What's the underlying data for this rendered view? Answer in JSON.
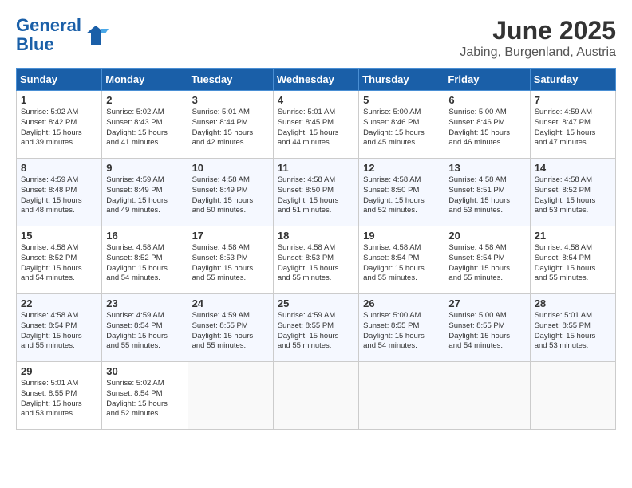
{
  "header": {
    "logo_line1": "General",
    "logo_line2": "Blue",
    "month": "June 2025",
    "location": "Jabing, Burgenland, Austria"
  },
  "weekdays": [
    "Sunday",
    "Monday",
    "Tuesday",
    "Wednesday",
    "Thursday",
    "Friday",
    "Saturday"
  ],
  "weeks": [
    [
      {
        "day": "1",
        "info": "Sunrise: 5:02 AM\nSunset: 8:42 PM\nDaylight: 15 hours\nand 39 minutes."
      },
      {
        "day": "2",
        "info": "Sunrise: 5:02 AM\nSunset: 8:43 PM\nDaylight: 15 hours\nand 41 minutes."
      },
      {
        "day": "3",
        "info": "Sunrise: 5:01 AM\nSunset: 8:44 PM\nDaylight: 15 hours\nand 42 minutes."
      },
      {
        "day": "4",
        "info": "Sunrise: 5:01 AM\nSunset: 8:45 PM\nDaylight: 15 hours\nand 44 minutes."
      },
      {
        "day": "5",
        "info": "Sunrise: 5:00 AM\nSunset: 8:46 PM\nDaylight: 15 hours\nand 45 minutes."
      },
      {
        "day": "6",
        "info": "Sunrise: 5:00 AM\nSunset: 8:46 PM\nDaylight: 15 hours\nand 46 minutes."
      },
      {
        "day": "7",
        "info": "Sunrise: 4:59 AM\nSunset: 8:47 PM\nDaylight: 15 hours\nand 47 minutes."
      }
    ],
    [
      {
        "day": "8",
        "info": "Sunrise: 4:59 AM\nSunset: 8:48 PM\nDaylight: 15 hours\nand 48 minutes."
      },
      {
        "day": "9",
        "info": "Sunrise: 4:59 AM\nSunset: 8:49 PM\nDaylight: 15 hours\nand 49 minutes."
      },
      {
        "day": "10",
        "info": "Sunrise: 4:58 AM\nSunset: 8:49 PM\nDaylight: 15 hours\nand 50 minutes."
      },
      {
        "day": "11",
        "info": "Sunrise: 4:58 AM\nSunset: 8:50 PM\nDaylight: 15 hours\nand 51 minutes."
      },
      {
        "day": "12",
        "info": "Sunrise: 4:58 AM\nSunset: 8:50 PM\nDaylight: 15 hours\nand 52 minutes."
      },
      {
        "day": "13",
        "info": "Sunrise: 4:58 AM\nSunset: 8:51 PM\nDaylight: 15 hours\nand 53 minutes."
      },
      {
        "day": "14",
        "info": "Sunrise: 4:58 AM\nSunset: 8:52 PM\nDaylight: 15 hours\nand 53 minutes."
      }
    ],
    [
      {
        "day": "15",
        "info": "Sunrise: 4:58 AM\nSunset: 8:52 PM\nDaylight: 15 hours\nand 54 minutes."
      },
      {
        "day": "16",
        "info": "Sunrise: 4:58 AM\nSunset: 8:52 PM\nDaylight: 15 hours\nand 54 minutes."
      },
      {
        "day": "17",
        "info": "Sunrise: 4:58 AM\nSunset: 8:53 PM\nDaylight: 15 hours\nand 55 minutes."
      },
      {
        "day": "18",
        "info": "Sunrise: 4:58 AM\nSunset: 8:53 PM\nDaylight: 15 hours\nand 55 minutes."
      },
      {
        "day": "19",
        "info": "Sunrise: 4:58 AM\nSunset: 8:54 PM\nDaylight: 15 hours\nand 55 minutes."
      },
      {
        "day": "20",
        "info": "Sunrise: 4:58 AM\nSunset: 8:54 PM\nDaylight: 15 hours\nand 55 minutes."
      },
      {
        "day": "21",
        "info": "Sunrise: 4:58 AM\nSunset: 8:54 PM\nDaylight: 15 hours\nand 55 minutes."
      }
    ],
    [
      {
        "day": "22",
        "info": "Sunrise: 4:58 AM\nSunset: 8:54 PM\nDaylight: 15 hours\nand 55 minutes."
      },
      {
        "day": "23",
        "info": "Sunrise: 4:59 AM\nSunset: 8:54 PM\nDaylight: 15 hours\nand 55 minutes."
      },
      {
        "day": "24",
        "info": "Sunrise: 4:59 AM\nSunset: 8:55 PM\nDaylight: 15 hours\nand 55 minutes."
      },
      {
        "day": "25",
        "info": "Sunrise: 4:59 AM\nSunset: 8:55 PM\nDaylight: 15 hours\nand 55 minutes."
      },
      {
        "day": "26",
        "info": "Sunrise: 5:00 AM\nSunset: 8:55 PM\nDaylight: 15 hours\nand 54 minutes."
      },
      {
        "day": "27",
        "info": "Sunrise: 5:00 AM\nSunset: 8:55 PM\nDaylight: 15 hours\nand 54 minutes."
      },
      {
        "day": "28",
        "info": "Sunrise: 5:01 AM\nSunset: 8:55 PM\nDaylight: 15 hours\nand 53 minutes."
      }
    ],
    [
      {
        "day": "29",
        "info": "Sunrise: 5:01 AM\nSunset: 8:55 PM\nDaylight: 15 hours\nand 53 minutes."
      },
      {
        "day": "30",
        "info": "Sunrise: 5:02 AM\nSunset: 8:54 PM\nDaylight: 15 hours\nand 52 minutes."
      },
      {
        "day": "",
        "info": ""
      },
      {
        "day": "",
        "info": ""
      },
      {
        "day": "",
        "info": ""
      },
      {
        "day": "",
        "info": ""
      },
      {
        "day": "",
        "info": ""
      }
    ]
  ]
}
